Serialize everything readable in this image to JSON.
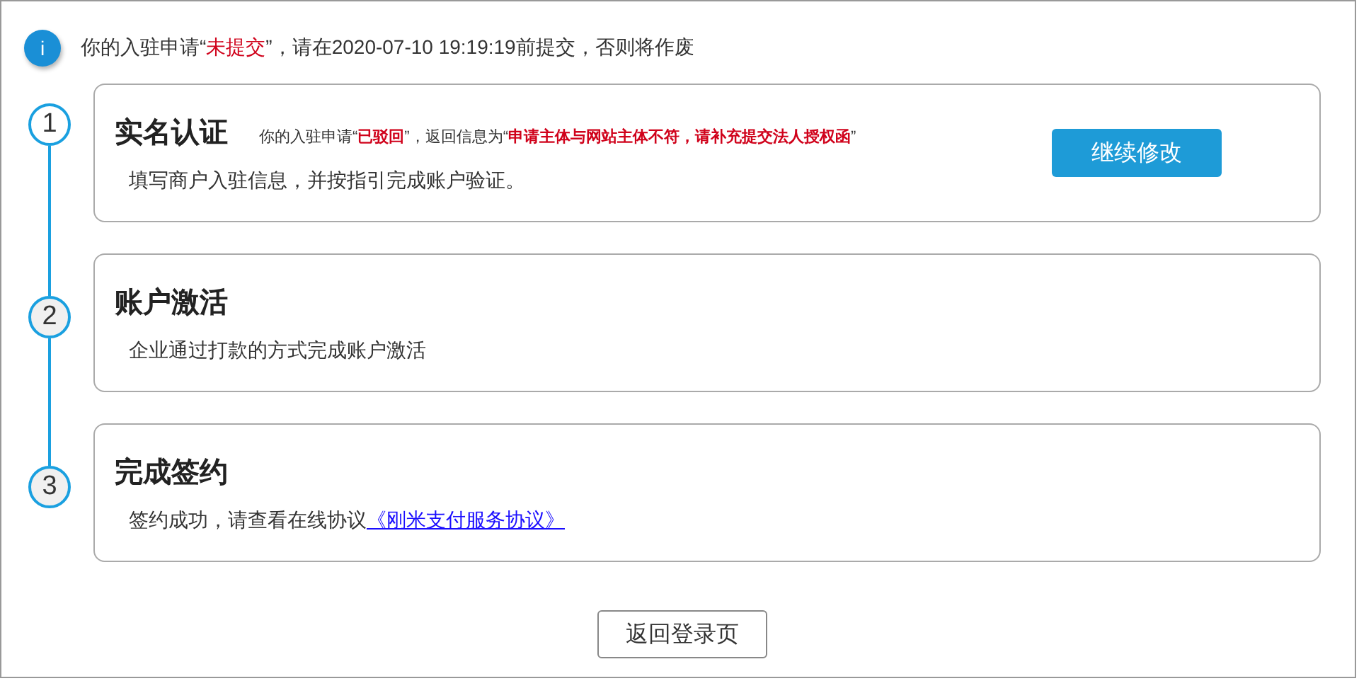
{
  "notice": {
    "icon": "i",
    "segments": [
      {
        "text": "你的入驻申请“",
        "emphasis": false
      },
      {
        "text": "未提交",
        "emphasis": true
      },
      {
        "text": "”，请在2020-07-10 19:19:19前提交，否则将作废",
        "emphasis": false
      }
    ]
  },
  "steps": [
    {
      "number": "1",
      "current": true,
      "title": "实名认证",
      "note": [
        {
          "text": "你的入驻申请“",
          "emphasis": false
        },
        {
          "text": "已驳回",
          "emphasis": true
        },
        {
          "text": "”，返回信息为“",
          "emphasis": false
        },
        {
          "text": "申请主体与网站主体不符，请补充提交法人授权函",
          "emphasis": true
        },
        {
          "text": "”",
          "emphasis": false
        }
      ],
      "description": "填写商户入驻信息，并按指引完成账户验证。",
      "action": "继续修改"
    },
    {
      "number": "2",
      "current": false,
      "title": "账户激活",
      "description": "企业通过打款的方式完成账户激活"
    },
    {
      "number": "3",
      "current": false,
      "title": "完成签约",
      "description": "签约成功，请查看在线协议",
      "link": "《刚米支付服务协议》"
    }
  ],
  "back_button": "返回登录页"
}
